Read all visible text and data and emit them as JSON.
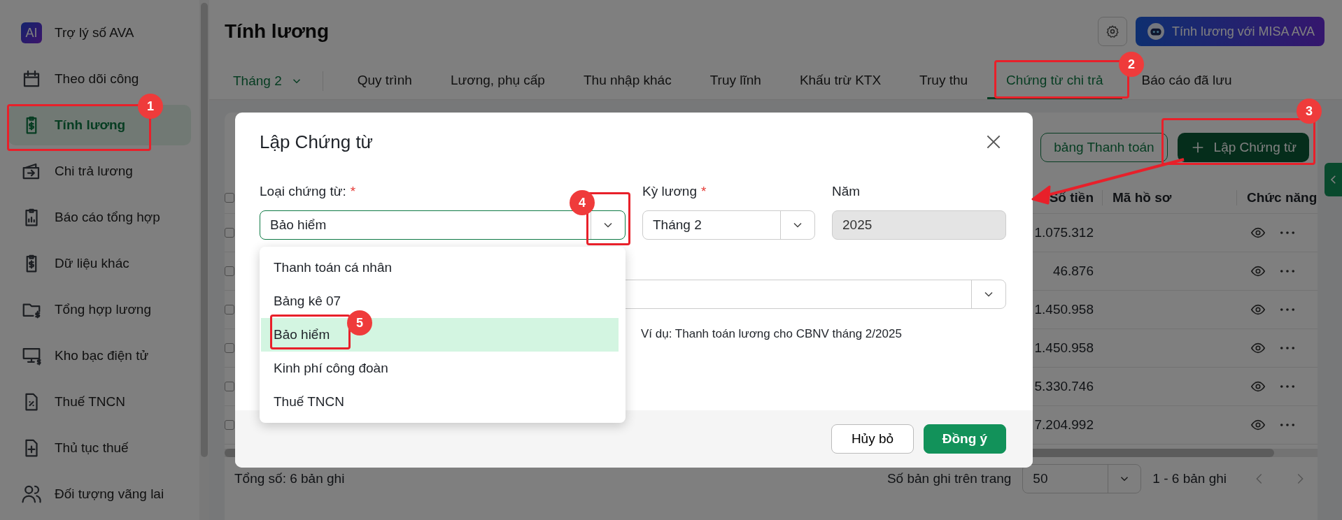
{
  "sidebar": {
    "items": [
      {
        "label": "Trợ lý số AVA",
        "badge": "AI",
        "selected": false
      },
      {
        "label": "Theo dõi công",
        "selected": false
      },
      {
        "label": "Tính lương",
        "selected": true
      },
      {
        "label": "Chi trả lương",
        "selected": false
      },
      {
        "label": "Báo cáo tổng hợp",
        "selected": false
      },
      {
        "label": "Dữ liệu khác",
        "selected": false
      },
      {
        "label": "Tổng hợp lương",
        "selected": false
      },
      {
        "label": "Kho bạc điện tử",
        "selected": false
      },
      {
        "label": "Thuế TNCN",
        "selected": false
      },
      {
        "label": "Thủ tục thuế",
        "selected": false
      },
      {
        "label": "Đối tượng vãng lai",
        "selected": false
      }
    ]
  },
  "header": {
    "title": "Tính lương",
    "ava_button": "Tính lương với MISA AVA"
  },
  "tabs": {
    "period": "Tháng 2",
    "items": [
      {
        "label": "Quy trình",
        "selected": false
      },
      {
        "label": "Lương, phụ cấp",
        "selected": false
      },
      {
        "label": "Thu nhập khác",
        "selected": false
      },
      {
        "label": "Truy lĩnh",
        "selected": false
      },
      {
        "label": "Khấu trừ KTX",
        "selected": false
      },
      {
        "label": "Truy thu",
        "selected": false
      },
      {
        "label": "Chứng từ chi trả",
        "selected": true
      },
      {
        "label": "Báo cáo đã lưu",
        "selected": false
      }
    ]
  },
  "toolbar": {
    "buttons": [
      {
        "label": "bảng Thanh toán",
        "kind": "outline"
      },
      {
        "label": "Lập Chứng từ",
        "kind": "primary"
      }
    ]
  },
  "table": {
    "columns": [
      "Số tiền",
      "Mã hồ sơ",
      "Chức năng"
    ],
    "all_checked": false,
    "rows": [
      {
        "checked": false,
        "amount": "1.075.312"
      },
      {
        "checked": false,
        "amount": "46.876"
      },
      {
        "checked": false,
        "amount": "1.450.958"
      },
      {
        "checked": false,
        "amount": "1.450.958"
      },
      {
        "checked": false,
        "amount": "5.330.746"
      },
      {
        "checked": false,
        "amount": "7.204.992"
      }
    ]
  },
  "footer": {
    "total": "Tổng số: 6 bản ghi",
    "page_size_label": "Số bản ghi trên trang",
    "page_size": "50",
    "range": "1 - 6 bản ghi"
  },
  "modal": {
    "title": "Lập Chứng từ",
    "fields": [
      {
        "label": "Loại chứng từ:",
        "required_mark": "*",
        "value": "Bảo hiểm",
        "disabled": false,
        "kind": "select"
      },
      {
        "label": "Kỳ lương",
        "required_mark": "*",
        "value": "Tháng 2",
        "disabled": false,
        "kind": "select"
      },
      {
        "label": "Năm",
        "value": "2025",
        "disabled": true,
        "kind": "text"
      }
    ],
    "dropdown": [
      {
        "label": "Thanh toán cá nhân",
        "selected": false
      },
      {
        "label": "Bảng kê 07",
        "selected": false
      },
      {
        "label": "Bảo hiểm",
        "selected": true
      },
      {
        "label": "Kinh phí công đoàn",
        "selected": false
      },
      {
        "label": "Thuế TNCN",
        "selected": false
      }
    ],
    "hint": "Ví dụ: Thanh toán lương cho CBNV tháng 2/2025",
    "buttons": [
      {
        "label": "Hủy bỏ",
        "kind": "secondary"
      },
      {
        "label": "Đồng ý",
        "kind": "primary"
      }
    ]
  },
  "annotations": [
    {
      "number": "1"
    },
    {
      "number": "2"
    },
    {
      "number": "3"
    },
    {
      "number": "4"
    },
    {
      "number": "5"
    }
  ]
}
